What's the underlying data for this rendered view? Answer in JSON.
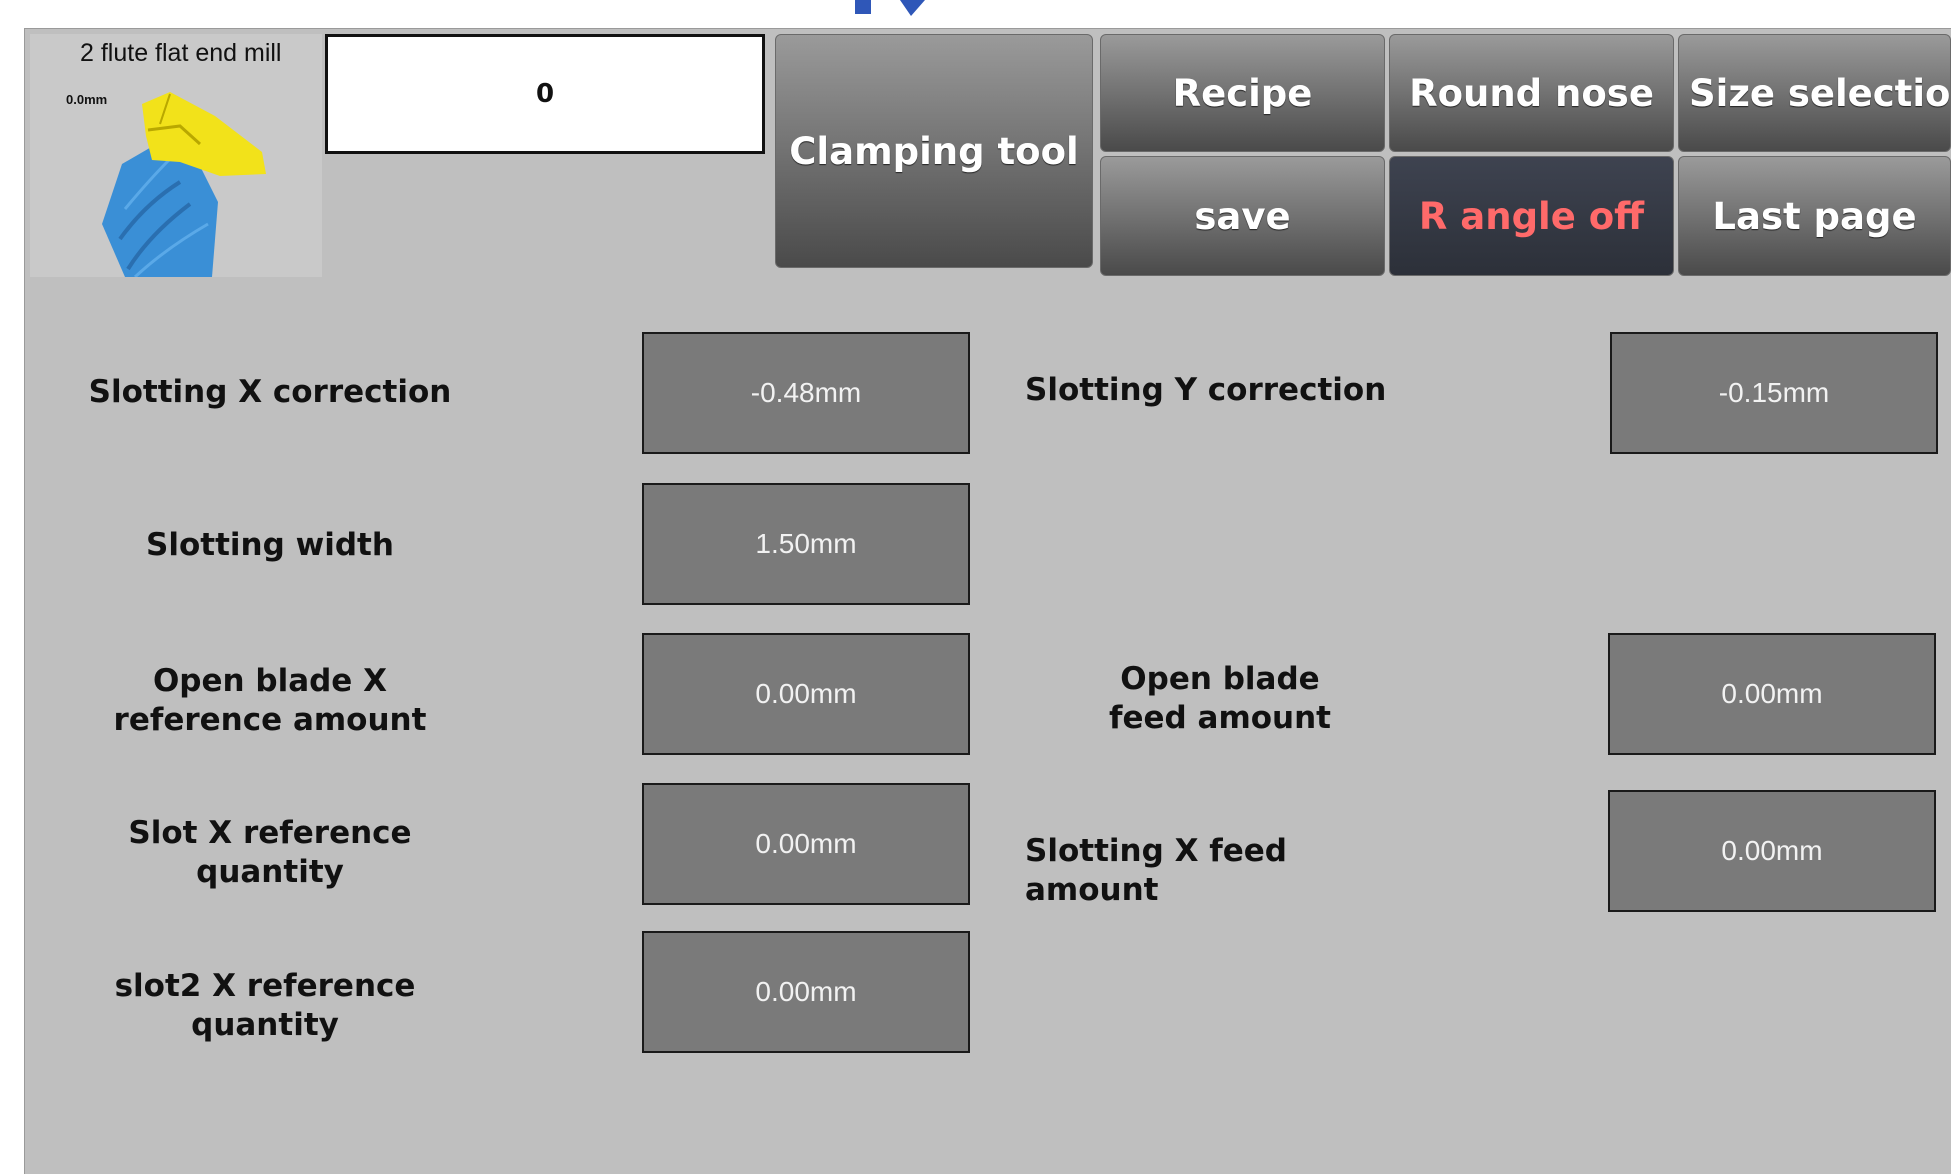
{
  "tool": {
    "name": "2 flute flat end mill",
    "dimension_label": "0.0mm",
    "icon": "end-mill-icon"
  },
  "value_display": "0",
  "buttons": {
    "clamping_tool": "Clamping tool",
    "recipe": "Recipe",
    "round_nose": "Round nose",
    "size_selection": "Size selection",
    "save": "save",
    "r_angle": "R angle off",
    "last_page": "Last page"
  },
  "parameters": {
    "slotting_x_correction": {
      "label": "Slotting X correction",
      "value": "-0.48mm"
    },
    "slotting_y_correction": {
      "label": "Slotting Y correction",
      "value": "-0.15mm"
    },
    "slotting_width": {
      "label": "Slotting width",
      "value": "1.50mm"
    },
    "open_blade_x_reference": {
      "label": "Open blade X\nreference amount",
      "value": "0.00mm"
    },
    "open_blade_feed": {
      "label": "Open blade\nfeed amount",
      "value": "0.00mm"
    },
    "slot_x_reference": {
      "label": "Slot X reference\nquantity",
      "value": "0.00mm"
    },
    "slotting_x_feed": {
      "label": "Slotting X feed amount",
      "value": "0.00mm"
    },
    "slot2_x_reference": {
      "label": "slot2 X reference\nquantity",
      "value": "0.00mm"
    }
  },
  "colors": {
    "panel_background": "#bfbfbf",
    "field_background": "#7a7a7a",
    "r_angle_text": "#ff6a6a",
    "tool_yellow": "#f2e21a",
    "tool_blue": "#3a8fd6"
  }
}
